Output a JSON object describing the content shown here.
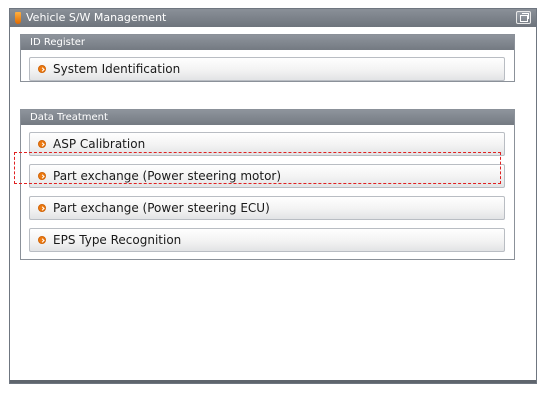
{
  "window": {
    "title": "Vehicle S/W Management",
    "restore_icon": "restore-window-icon"
  },
  "groups": [
    {
      "title": "ID Register",
      "items": [
        {
          "label": "System Identification",
          "icon": "orange-bullet-icon"
        }
      ]
    },
    {
      "title": "Data Treatment",
      "items": [
        {
          "label": "ASP Calibration",
          "icon": "orange-bullet-icon"
        },
        {
          "label": "Part exchange (Power steering motor)",
          "icon": "orange-bullet-icon",
          "selected": true
        },
        {
          "label": "Part exchange (Power steering ECU)",
          "icon": "orange-bullet-icon"
        },
        {
          "label": "EPS Type Recognition",
          "icon": "orange-bullet-icon"
        }
      ]
    }
  ],
  "colors": {
    "accent": "#ee7a10",
    "header": "#7e848c",
    "selection": "#e02020"
  }
}
